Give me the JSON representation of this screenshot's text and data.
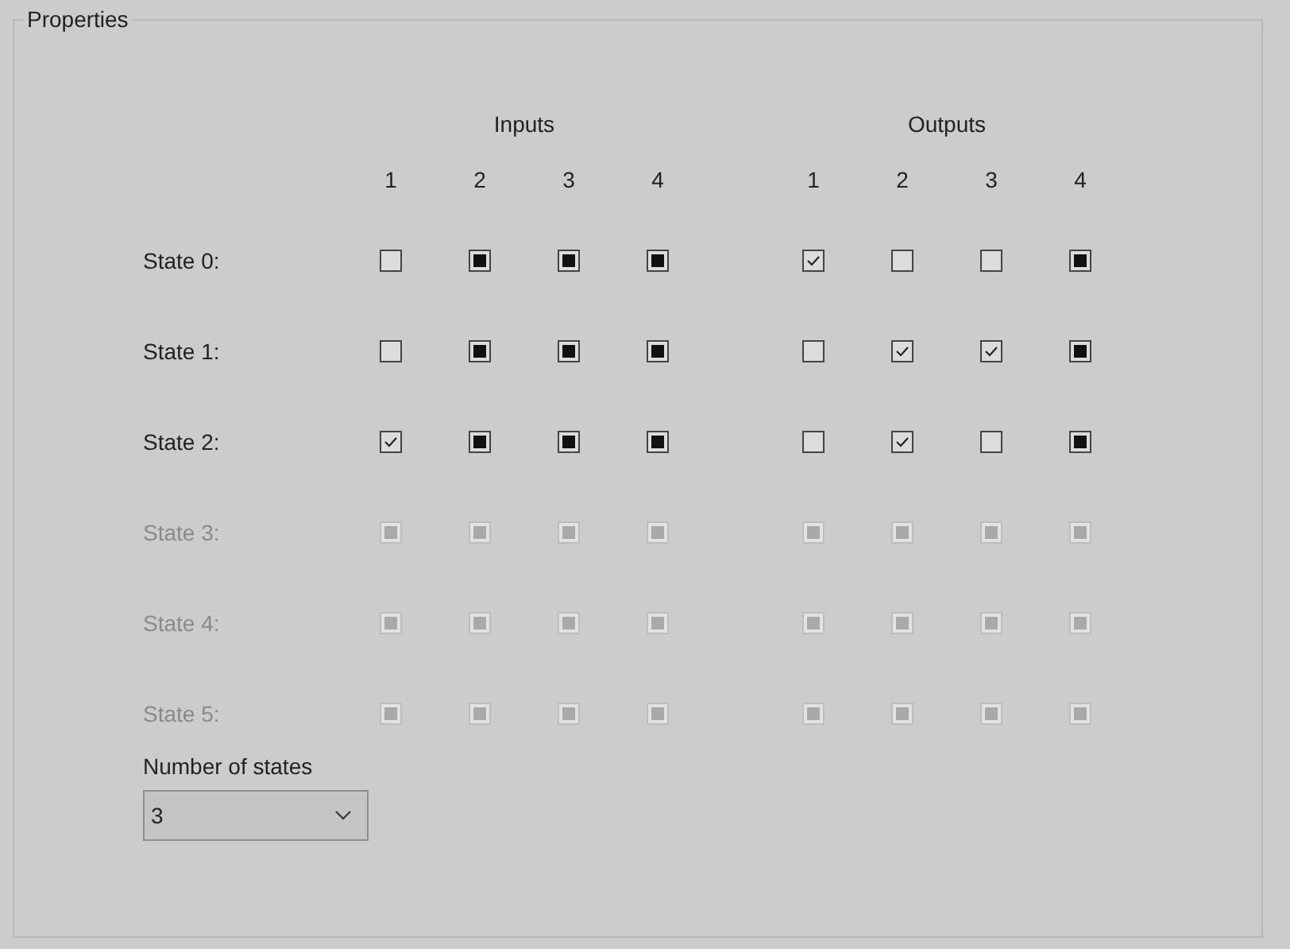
{
  "group": {
    "title": "Properties"
  },
  "headers": {
    "inputs": "Inputs",
    "outputs": "Outputs",
    "input_columns": [
      "1",
      "2",
      "3",
      "4"
    ],
    "output_columns": [
      "1",
      "2",
      "3",
      "4"
    ]
  },
  "states": [
    {
      "label": "State 0:",
      "disabled": false,
      "inputs": [
        {
          "checked": false,
          "mixed": false
        },
        {
          "checked": false,
          "mixed": true
        },
        {
          "checked": false,
          "mixed": true
        },
        {
          "checked": false,
          "mixed": true
        }
      ],
      "outputs": [
        {
          "checked": true,
          "mixed": false
        },
        {
          "checked": false,
          "mixed": false
        },
        {
          "checked": false,
          "mixed": false
        },
        {
          "checked": false,
          "mixed": true
        }
      ]
    },
    {
      "label": "State 1:",
      "disabled": false,
      "inputs": [
        {
          "checked": false,
          "mixed": false
        },
        {
          "checked": false,
          "mixed": true
        },
        {
          "checked": false,
          "mixed": true
        },
        {
          "checked": false,
          "mixed": true
        }
      ],
      "outputs": [
        {
          "checked": false,
          "mixed": false
        },
        {
          "checked": true,
          "mixed": false
        },
        {
          "checked": true,
          "mixed": false
        },
        {
          "checked": false,
          "mixed": true
        }
      ]
    },
    {
      "label": "State 2:",
      "disabled": false,
      "inputs": [
        {
          "checked": true,
          "mixed": false
        },
        {
          "checked": false,
          "mixed": true
        },
        {
          "checked": false,
          "mixed": true
        },
        {
          "checked": false,
          "mixed": true
        }
      ],
      "outputs": [
        {
          "checked": false,
          "mixed": false
        },
        {
          "checked": true,
          "mixed": false
        },
        {
          "checked": false,
          "mixed": false
        },
        {
          "checked": false,
          "mixed": true
        }
      ]
    },
    {
      "label": "State 3:",
      "disabled": true,
      "inputs": [
        {
          "checked": false,
          "mixed": true
        },
        {
          "checked": false,
          "mixed": true
        },
        {
          "checked": false,
          "mixed": true
        },
        {
          "checked": false,
          "mixed": true
        }
      ],
      "outputs": [
        {
          "checked": false,
          "mixed": true
        },
        {
          "checked": false,
          "mixed": true
        },
        {
          "checked": false,
          "mixed": true
        },
        {
          "checked": false,
          "mixed": true
        }
      ]
    },
    {
      "label": "State 4:",
      "disabled": true,
      "inputs": [
        {
          "checked": false,
          "mixed": true
        },
        {
          "checked": false,
          "mixed": true
        },
        {
          "checked": false,
          "mixed": true
        },
        {
          "checked": false,
          "mixed": true
        }
      ],
      "outputs": [
        {
          "checked": false,
          "mixed": true
        },
        {
          "checked": false,
          "mixed": true
        },
        {
          "checked": false,
          "mixed": true
        },
        {
          "checked": false,
          "mixed": true
        }
      ]
    },
    {
      "label": "State 5:",
      "disabled": true,
      "inputs": [
        {
          "checked": false,
          "mixed": true
        },
        {
          "checked": false,
          "mixed": true
        },
        {
          "checked": false,
          "mixed": true
        },
        {
          "checked": false,
          "mixed": true
        }
      ],
      "outputs": [
        {
          "checked": false,
          "mixed": true
        },
        {
          "checked": false,
          "mixed": true
        },
        {
          "checked": false,
          "mixed": true
        },
        {
          "checked": false,
          "mixed": true
        }
      ]
    }
  ],
  "number_of_states": {
    "label": "Number of states",
    "value": "3"
  }
}
